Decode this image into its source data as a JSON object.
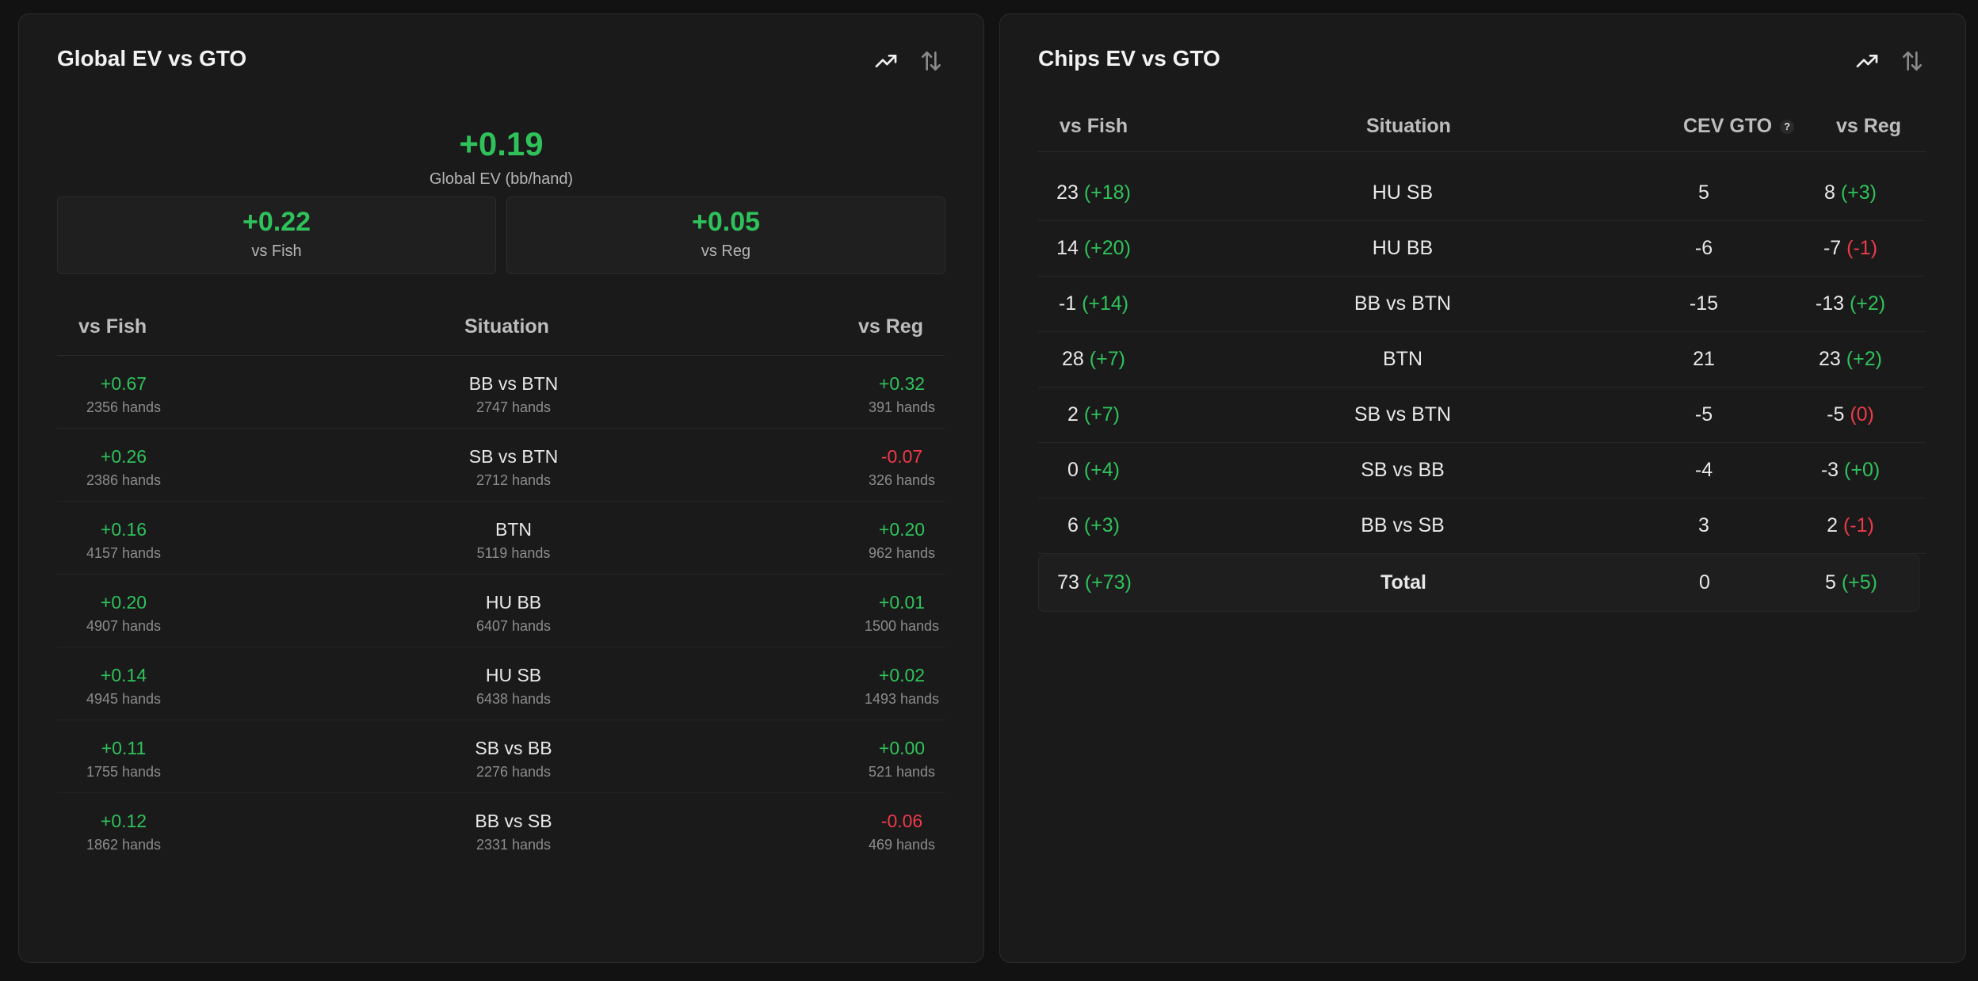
{
  "left_panel": {
    "title": "Global EV vs GTO",
    "icons": [
      "trending-up-icon",
      "sort-arrows-icon"
    ],
    "global_value": "+0.19",
    "global_label": "Global EV (bb/hand)",
    "fish_value": "+0.22",
    "fish_label": "vs Fish",
    "reg_value": "+0.05",
    "reg_label": "vs Reg",
    "headers": {
      "fish": "vs Fish",
      "situation": "Situation",
      "reg": "vs Reg"
    },
    "rows": [
      {
        "fish": "+0.67",
        "fish_hands": "2356 hands",
        "situation": "BB vs BTN",
        "sit_hands": "2747 hands",
        "reg": "+0.32",
        "reg_hands": "391 hands",
        "reg_sign": "pos"
      },
      {
        "fish": "+0.26",
        "fish_hands": "2386 hands",
        "situation": "SB vs BTN",
        "sit_hands": "2712 hands",
        "reg": "-0.07",
        "reg_hands": "326 hands",
        "reg_sign": "neg"
      },
      {
        "fish": "+0.16",
        "fish_hands": "4157 hands",
        "situation": "BTN",
        "sit_hands": "5119 hands",
        "reg": "+0.20",
        "reg_hands": "962 hands",
        "reg_sign": "pos"
      },
      {
        "fish": "+0.20",
        "fish_hands": "4907 hands",
        "situation": "HU BB",
        "sit_hands": "6407 hands",
        "reg": "+0.01",
        "reg_hands": "1500 hands",
        "reg_sign": "pos"
      },
      {
        "fish": "+0.14",
        "fish_hands": "4945 hands",
        "situation": "HU SB",
        "sit_hands": "6438 hands",
        "reg": "+0.02",
        "reg_hands": "1493 hands",
        "reg_sign": "pos"
      },
      {
        "fish": "+0.11",
        "fish_hands": "1755 hands",
        "situation": "SB vs BB",
        "sit_hands": "2276 hands",
        "reg": "+0.00",
        "reg_hands": "521 hands",
        "reg_sign": "pos"
      },
      {
        "fish": "+0.12",
        "fish_hands": "1862 hands",
        "situation": "BB vs SB",
        "sit_hands": "2331 hands",
        "reg": "-0.06",
        "reg_hands": "469 hands",
        "reg_sign": "neg"
      }
    ]
  },
  "right_panel": {
    "title": "Chips EV vs GTO",
    "icons": [
      "trending-up-icon",
      "sort-arrows-icon"
    ],
    "headers": {
      "fish": "vs Fish",
      "situation": "Situation",
      "cev": "CEV GTO",
      "help": "?",
      "reg": "vs Reg"
    },
    "rows": [
      {
        "fish": "23",
        "fish_diff": "(+18)",
        "fish_sign": "pos",
        "situation": "HU SB",
        "cev": "5",
        "reg": "8",
        "reg_diff": "(+3)",
        "reg_sign": "pos"
      },
      {
        "fish": "14",
        "fish_diff": "(+20)",
        "fish_sign": "pos",
        "situation": "HU BB",
        "cev": "-6",
        "reg": "-7",
        "reg_diff": "(-1)",
        "reg_sign": "neg"
      },
      {
        "fish": "-1",
        "fish_diff": "(+14)",
        "fish_sign": "pos",
        "situation": "BB vs BTN",
        "cev": "-15",
        "reg": "-13",
        "reg_diff": "(+2)",
        "reg_sign": "pos"
      },
      {
        "fish": "28",
        "fish_diff": "(+7)",
        "fish_sign": "pos",
        "situation": "BTN",
        "cev": "21",
        "reg": "23",
        "reg_diff": "(+2)",
        "reg_sign": "pos"
      },
      {
        "fish": "2",
        "fish_diff": "(+7)",
        "fish_sign": "pos",
        "situation": "SB vs BTN",
        "cev": "-5",
        "reg": "-5",
        "reg_diff": "(0)",
        "reg_sign": "neg"
      },
      {
        "fish": "0",
        "fish_diff": "(+4)",
        "fish_sign": "pos",
        "situation": "SB vs BB",
        "cev": "-4",
        "reg": "-3",
        "reg_diff": "(+0)",
        "reg_sign": "pos"
      },
      {
        "fish": "6",
        "fish_diff": "(+3)",
        "fish_sign": "pos",
        "situation": "BB vs SB",
        "cev": "3",
        "reg": "2",
        "reg_diff": "(-1)",
        "reg_sign": "neg"
      }
    ],
    "total": {
      "fish": "73",
      "fish_diff": "(+73)",
      "situation": "Total",
      "cev": "0",
      "reg": "5",
      "reg_diff": "(+5)"
    }
  },
  "colors": {
    "positive": "#2fc25b",
    "negative": "#ef3a49",
    "background": "#121212",
    "panel": "#1a1a1a"
  }
}
